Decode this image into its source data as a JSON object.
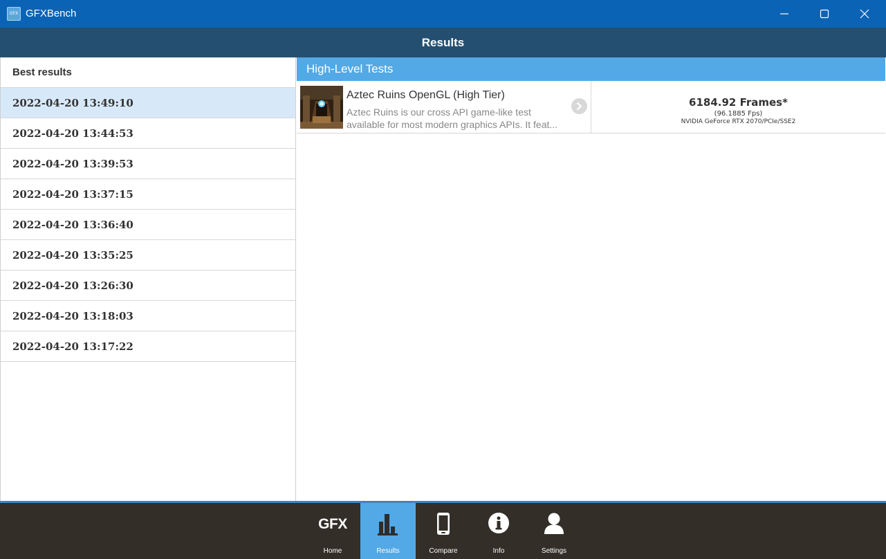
{
  "window": {
    "title": "GFXBench",
    "icon_text": "GFX"
  },
  "header": {
    "title": "Results"
  },
  "left_panel": {
    "heading": "Best results",
    "dates": [
      "2022-04-20 13:49:10",
      "2022-04-20 13:44:53",
      "2022-04-20 13:39:53",
      "2022-04-20 13:37:15",
      "2022-04-20 13:36:40",
      "2022-04-20 13:35:25",
      "2022-04-20 13:26:30",
      "2022-04-20 13:18:03",
      "2022-04-20 13:17:22"
    ],
    "selected_index": 0
  },
  "right_panel": {
    "section_title": "High-Level Tests",
    "tests": [
      {
        "name": "Aztec Ruins OpenGL (High Tier)",
        "description": "Aztec Ruins is our cross API game-like test available for most modern graphics APIs. It feat...",
        "score": "6184.92 Frames*",
        "fps": "(96.1885 Fps)",
        "gpu": "NVIDIA GeForce RTX 2070/PCIe/SSE2"
      }
    ]
  },
  "bottom_nav": {
    "items": [
      {
        "label": "Home",
        "icon": "gfx-logo",
        "text": "GFX"
      },
      {
        "label": "Results",
        "icon": "bar-chart-icon"
      },
      {
        "label": "Compare",
        "icon": "phone-icon"
      },
      {
        "label": "Info",
        "icon": "info-icon"
      },
      {
        "label": "Settings",
        "icon": "user-icon"
      }
    ],
    "active": "Results"
  },
  "colors": {
    "titlebar": "#0a63b5",
    "header": "#244f70",
    "accent": "#52a9e6",
    "selected_row": "#d7e9f9",
    "nav_bg": "#332e27"
  }
}
